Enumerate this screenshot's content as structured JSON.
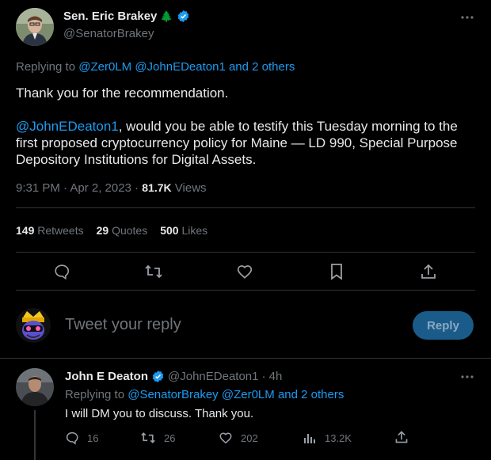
{
  "tweet": {
    "author_name": "Sen. Eric Brakey",
    "tree_emoji": "🌲",
    "author_handle": "@SenatorBrakey",
    "replying_to_prefix": "Replying to ",
    "replying_to_1": "@Zer0LM",
    "replying_to_2": "@JohnEDeaton1",
    "replying_to_others": "and 2 others",
    "text_line1": "Thank you for the recommendation.",
    "mention": "@JohnEDeaton1",
    "text_p2_rest": ", would you be able to testify this Tuesday morning to the first proposed cryptocurrency policy for Maine — LD 990, Special Purpose Depository Institutions for Digital Assets.",
    "timestamp": "9:31 PM · Apr 2, 2023 · ",
    "views_count": "81.7K",
    "views_label": " Views",
    "retweets_count": "149",
    "retweets_label": "Retweets",
    "quotes_count": "29",
    "quotes_label": "Quotes",
    "likes_count": "500",
    "likes_label": "Likes"
  },
  "compose": {
    "placeholder": "Tweet your reply",
    "reply_button": "Reply"
  },
  "reply": {
    "author_name": "John E Deaton",
    "author_handle": "@JohnEDeaton1",
    "time": "· 4h",
    "replying_to_prefix": "Replying to ",
    "replying_to_1": "@SenatorBrakey",
    "replying_to_2": "@Zer0LM",
    "replying_to_others": "and 2 others",
    "text": "I will DM you to discuss. Thank you.",
    "replies_count": "16",
    "retweets_count": "26",
    "likes_count": "202",
    "views_count": "13.2K"
  },
  "colors": {
    "accent": "#1d9bf0",
    "muted": "#71767b",
    "text": "#e7e9ea",
    "divider": "#2f3336",
    "tree": "#3a9b3a"
  }
}
